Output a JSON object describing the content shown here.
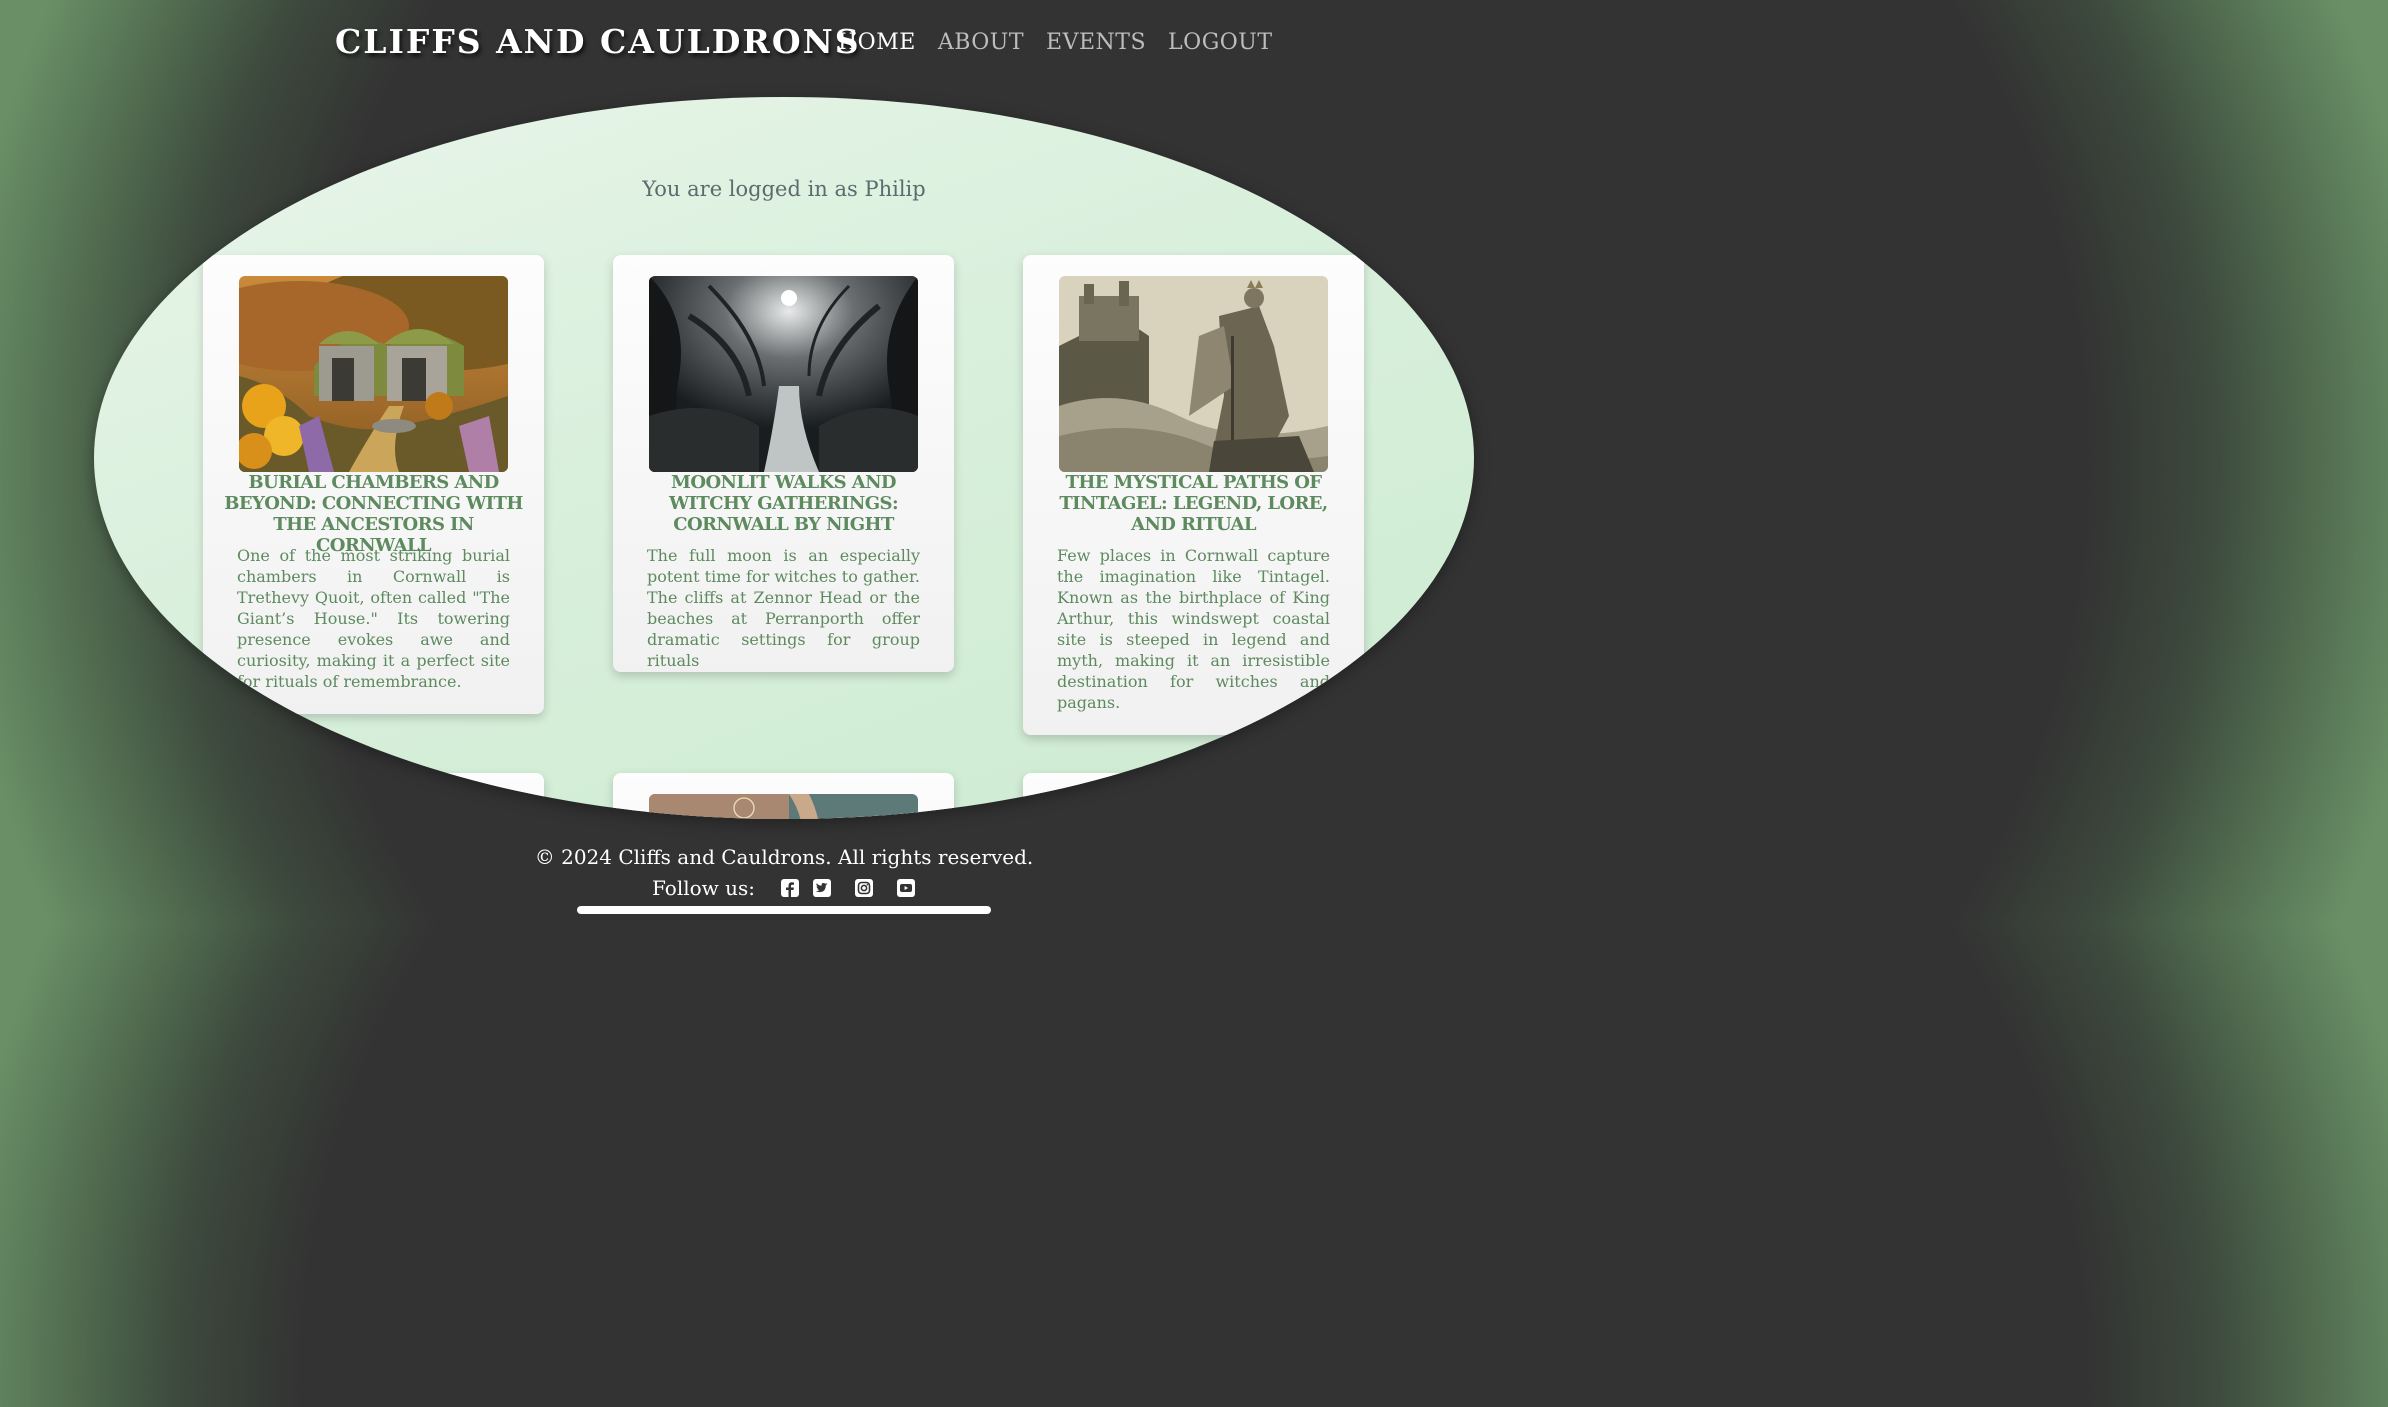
{
  "header": {
    "site_title": "Cliffs and Cauldrons",
    "nav": [
      {
        "label": "Home",
        "active": true
      },
      {
        "label": "About",
        "active": false
      },
      {
        "label": "Events",
        "active": false
      },
      {
        "label": "Logout",
        "active": false
      }
    ]
  },
  "main": {
    "login_message": "You are logged in as Philip",
    "cards": [
      {
        "image": "burial-chamber-heathland-image",
        "title": "Burial Chambers and Beyond: Connecting with the Ancestors in Cornwall",
        "text": "One of the most striking burial chambers in Cornwall is Trethevy Quoit, often called \"The Giant’s House.\" Its towering presence evokes awe and curiosity, making it a perfect site for rituals of remembrance."
      },
      {
        "image": "moonlit-forest-path-image",
        "title": "Moonlit Walks and Witchy Gatherings: Cornwall by Night",
        "text": "The full moon is an especially potent time for witches to gather. The cliffs at Zennor Head or the beaches at Perranporth offer dramatic settings for group rituals"
      },
      {
        "image": "tintagel-king-arthur-image",
        "title": "The Mystical Paths of Tintagel: Legend, Lore, and Ritual",
        "text": "Few places in Cornwall capture the imagination like Tintagel. Known as the birthplace of King Arthur, this windswept coastal site is steeped in legend and myth, making it an irresistible destination for witches and pagans."
      }
    ]
  },
  "footer": {
    "copyright": "© 2024 Cliffs and Cauldrons. All rights reserved.",
    "follow_label": "Follow us:",
    "social_icons": [
      "facebook-icon",
      "twitter-icon",
      "instagram-icon",
      "youtube-icon"
    ]
  },
  "colors": {
    "background_dark": "#333333",
    "background_green": "#6a8f66",
    "stage_green": "#d9f0dc",
    "card_text_green": "#5d8a5e"
  }
}
